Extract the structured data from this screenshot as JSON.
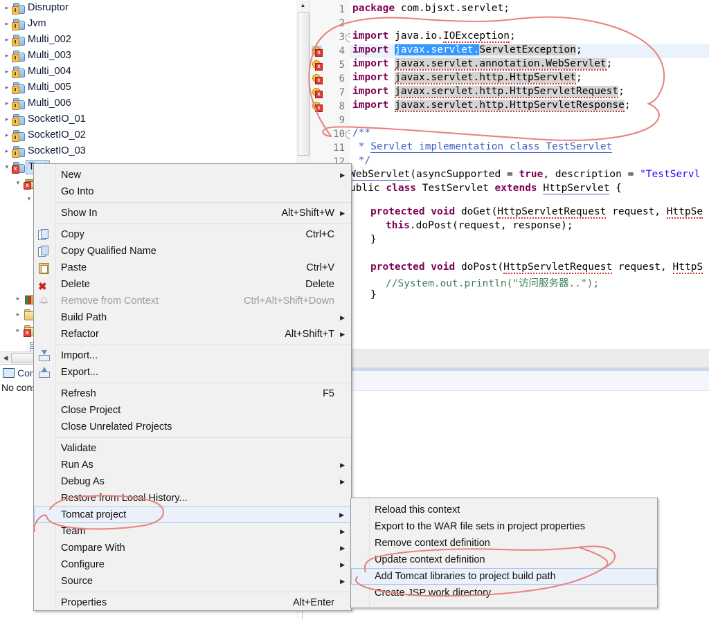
{
  "tree": {
    "items": [
      {
        "label": "Disruptor",
        "icon": "java-project-icon",
        "expanded": false,
        "indent": 0,
        "selected": false
      },
      {
        "label": "Jvm",
        "icon": "java-project-icon",
        "expanded": false,
        "indent": 0,
        "selected": false
      },
      {
        "label": "Multi_002",
        "icon": "java-project-icon",
        "expanded": false,
        "indent": 0,
        "selected": false
      },
      {
        "label": "Multi_003",
        "icon": "java-project-icon",
        "expanded": false,
        "indent": 0,
        "selected": false
      },
      {
        "label": "Multi_004",
        "icon": "java-project-icon",
        "expanded": false,
        "indent": 0,
        "selected": false
      },
      {
        "label": "Multi_005",
        "icon": "java-project-icon",
        "expanded": false,
        "indent": 0,
        "selected": false
      },
      {
        "label": "Multi_006",
        "icon": "java-project-icon",
        "expanded": false,
        "indent": 0,
        "selected": false
      },
      {
        "label": "SocketIO_01",
        "icon": "java-project-icon",
        "expanded": false,
        "indent": 0,
        "selected": false
      },
      {
        "label": "SocketIO_02",
        "icon": "java-project-icon",
        "expanded": false,
        "indent": 0,
        "selected": false
      },
      {
        "label": "SocketIO_03",
        "icon": "java-project-icon",
        "expanded": false,
        "indent": 0,
        "selected": false
      },
      {
        "label": "Test",
        "icon": "java-project-error-icon",
        "expanded": true,
        "indent": 0,
        "selected": true
      }
    ],
    "hidden_children": [
      {
        "label": "",
        "icon": "package-error-icon",
        "indent": 1
      },
      {
        "label": "",
        "icon": "package-icon",
        "indent": 2
      },
      {
        "label": "",
        "icon": "library-icon",
        "indent": 1
      },
      {
        "label": "",
        "icon": "folder-icon",
        "indent": 1
      },
      {
        "label": "",
        "icon": "folder-error-icon",
        "indent": 1
      },
      {
        "label": "",
        "icon": "file-icon",
        "indent": 2
      }
    ]
  },
  "console": {
    "tab_label": "Console",
    "tab_icon": "console-icon",
    "body_text": "No consoles to display at this time."
  },
  "editor": {
    "lines": [
      {
        "n": "1",
        "fold": "",
        "text": "package com.bjsxt.servlet;"
      },
      {
        "n": "2",
        "fold": "",
        "text": ""
      },
      {
        "n": "3",
        "fold": "-",
        "text": "import java.io.IOException;"
      },
      {
        "n": "4",
        "fold": "",
        "text": "import javax.servlet.ServletException;"
      },
      {
        "n": "5",
        "fold": "",
        "text": "import javax.servlet.annotation.WebServlet;"
      },
      {
        "n": "6",
        "fold": "",
        "text": "import javax.servlet.http.HttpServlet;"
      },
      {
        "n": "7",
        "fold": "",
        "text": "import javax.servlet.http.HttpServletRequest;"
      },
      {
        "n": "8",
        "fold": "",
        "text": "import javax.servlet.http.HttpServletResponse;"
      },
      {
        "n": "9",
        "fold": "",
        "text": ""
      },
      {
        "n": "10",
        "fold": "-",
        "text": "/**"
      },
      {
        "n": "11",
        "fold": "",
        "text": " * Servlet implementation class TestServlet"
      },
      {
        "n": "12",
        "fold": "",
        "text": " */"
      }
    ],
    "clipped_lines": [
      "WebServlet(asyncSupported = true, description = \"TestServl",
      "ublic class TestServlet extends HttpServlet {",
      "protected void doGet(HttpServletRequest request, HttpSe",
      "this.doPost(request, response);",
      "}",
      "protected void doPost(HttpServletRequest request, HttpS",
      "//System.out.println(\"访问服务器..\");",
      "}"
    ],
    "selected_text": "javax.servlet.",
    "error_marker_lines": [
      "4",
      "5",
      "6",
      "7",
      "8"
    ],
    "highlighted_line": "4"
  },
  "context_menu": {
    "groups": [
      [
        {
          "label": "New",
          "accel": "",
          "arrow": true,
          "icon": "",
          "disabled": false
        },
        {
          "label": "Go Into",
          "accel": "",
          "arrow": false,
          "icon": "",
          "disabled": false
        }
      ],
      [
        {
          "label": "Show In",
          "accel": "Alt+Shift+W",
          "arrow": true,
          "icon": "",
          "disabled": false
        }
      ],
      [
        {
          "label": "Copy",
          "accel": "Ctrl+C",
          "arrow": false,
          "icon": "copy-icon",
          "disabled": false
        },
        {
          "label": "Copy Qualified Name",
          "accel": "",
          "arrow": false,
          "icon": "copy-qualified-icon",
          "disabled": false
        },
        {
          "label": "Paste",
          "accel": "Ctrl+V",
          "arrow": false,
          "icon": "paste-icon",
          "disabled": false
        },
        {
          "label": "Delete",
          "accel": "Delete",
          "arrow": false,
          "icon": "delete-icon",
          "disabled": false
        },
        {
          "label": "Remove from Context",
          "accel": "Ctrl+Alt+Shift+Down",
          "arrow": false,
          "icon": "remove-from-context-icon",
          "disabled": true
        },
        {
          "label": "Build Path",
          "accel": "",
          "arrow": true,
          "icon": "",
          "disabled": false
        },
        {
          "label": "Refactor",
          "accel": "Alt+Shift+T",
          "arrow": true,
          "icon": "",
          "disabled": false
        }
      ],
      [
        {
          "label": "Import...",
          "accel": "",
          "arrow": false,
          "icon": "import-icon",
          "disabled": false
        },
        {
          "label": "Export...",
          "accel": "",
          "arrow": false,
          "icon": "export-icon",
          "disabled": false
        }
      ],
      [
        {
          "label": "Refresh",
          "accel": "F5",
          "arrow": false,
          "icon": "",
          "disabled": false
        },
        {
          "label": "Close Project",
          "accel": "",
          "arrow": false,
          "icon": "",
          "disabled": false
        },
        {
          "label": "Close Unrelated Projects",
          "accel": "",
          "arrow": false,
          "icon": "",
          "disabled": false
        }
      ],
      [
        {
          "label": "Validate",
          "accel": "",
          "arrow": false,
          "icon": "",
          "disabled": false
        },
        {
          "label": "Run As",
          "accel": "",
          "arrow": true,
          "icon": "",
          "disabled": false
        },
        {
          "label": "Debug As",
          "accel": "",
          "arrow": true,
          "icon": "",
          "disabled": false
        },
        {
          "label": "Restore from Local History...",
          "accel": "",
          "arrow": false,
          "icon": "",
          "disabled": false
        },
        {
          "label": "Tomcat project",
          "accel": "",
          "arrow": true,
          "icon": "",
          "disabled": false,
          "highlighted": true
        },
        {
          "label": "Team",
          "accel": "",
          "arrow": true,
          "icon": "",
          "disabled": false
        },
        {
          "label": "Compare With",
          "accel": "",
          "arrow": true,
          "icon": "",
          "disabled": false
        },
        {
          "label": "Configure",
          "accel": "",
          "arrow": true,
          "icon": "",
          "disabled": false
        },
        {
          "label": "Source",
          "accel": "",
          "arrow": true,
          "icon": "",
          "disabled": false
        }
      ],
      [
        {
          "label": "Properties",
          "accel": "Alt+Enter",
          "arrow": false,
          "icon": "",
          "disabled": false
        }
      ]
    ]
  },
  "submenu": {
    "title": "Tomcat project",
    "items": [
      {
        "label": "Reload this context",
        "highlighted": false
      },
      {
        "label": "Export to the WAR file sets in project properties",
        "highlighted": false
      },
      {
        "label": "Remove context definition",
        "highlighted": false
      },
      {
        "label": "Update context definition",
        "highlighted": false
      },
      {
        "label": "Add Tomcat libraries to project build path",
        "highlighted": true
      },
      {
        "label": "Create JSP work directory",
        "highlighted": false
      }
    ]
  },
  "colors": {
    "menu_bg": "#f1f1f1",
    "menu_highlight_bg": "#eaf1fb",
    "menu_highlight_border": "#a8c7e8",
    "tree_selection_bg": "#cde2f7",
    "annotation_red": "#e8827f",
    "keyword": "#7f0055",
    "string": "#2a00ff",
    "javadoc": "#3f5fbf",
    "selection_blue": "#3399ff",
    "occurrence_gray": "#d4d4d4"
  },
  "annotations": {
    "count": 3,
    "shapes": [
      {
        "name": "circle-around-imports",
        "target": "import statements lines 3-9"
      },
      {
        "name": "circle-around-tomcat-project",
        "target": "Tomcat project menu item"
      },
      {
        "name": "circle-around-add-tomcat-libraries",
        "target": "Add Tomcat libraries to project build path"
      }
    ]
  }
}
